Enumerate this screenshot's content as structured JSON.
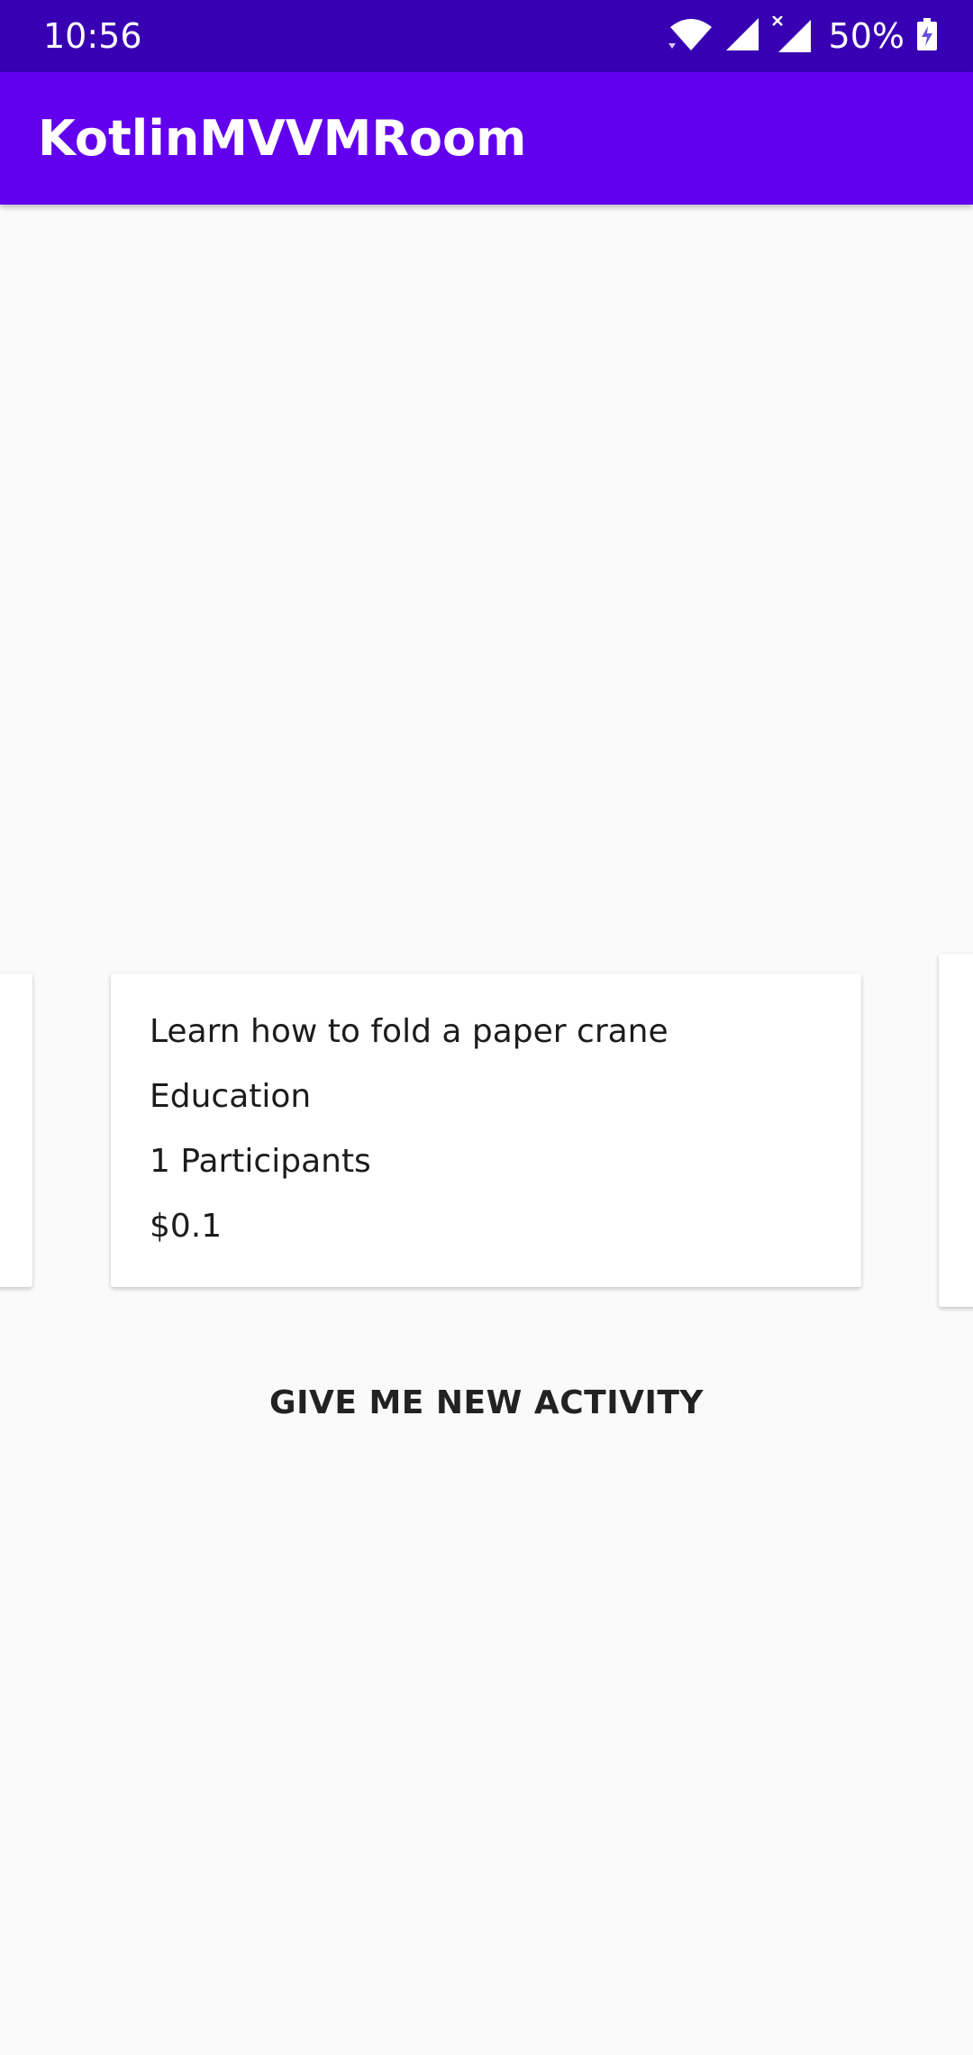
{
  "status_bar": {
    "time": "10:56",
    "battery_percent": "50%",
    "icons": [
      "wifi-icon",
      "signal-icon",
      "signal-no-data-icon",
      "battery-charging-icon"
    ],
    "background_color": "#3700b3"
  },
  "app_bar": {
    "title": "KotlinMVVMRoom",
    "background_color": "#6200ee"
  },
  "activity_card": {
    "activity": "Learn how to fold a paper crane",
    "type": "Education",
    "participants": "1 Participants",
    "price": "$0.1"
  },
  "action_button": {
    "label": "GIVE ME NEW ACTIVITY"
  }
}
